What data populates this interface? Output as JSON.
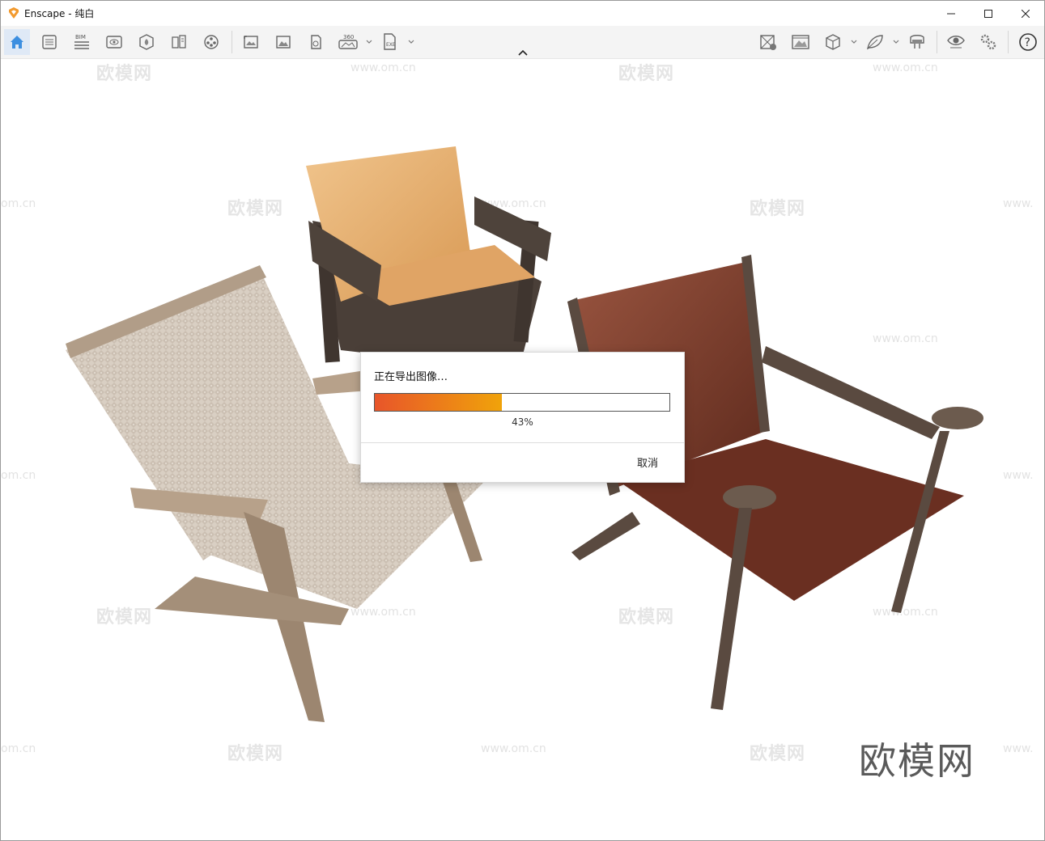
{
  "window": {
    "app_name": "Enscape",
    "title_sep": " - ",
    "project": "纯白"
  },
  "toolbar": {
    "left_icons": [
      "home-icon",
      "views-icon",
      "bim-icon",
      "visual-settings-icon",
      "asset-library-icon",
      "material-editor-icon",
      "video-editor-icon",
      "screenshot-icon",
      "batch-render-icon",
      "export-icon",
      "panorama-360-icon",
      "exe-export-icon"
    ],
    "bim_label": "BIM",
    "panorama_label": "360",
    "exe_label": "EXE",
    "right_icons": [
      "site-context-icon",
      "capture-icon",
      "model-cube-icon",
      "leaf-icon",
      "vr-headset-icon",
      "eye-icon",
      "settings-icon",
      "help-icon"
    ],
    "help_label": "?"
  },
  "watermark": {
    "brand": "欧模网",
    "url": "www.om.cn",
    "url_partial": "om.cn",
    "url_prefix": "www."
  },
  "dialog": {
    "title": "正在导出图像…",
    "progress": 43,
    "percent_text": "43%",
    "cancel_label": "取消",
    "bar_colors": [
      "#e8552a",
      "#f0a30a"
    ]
  }
}
